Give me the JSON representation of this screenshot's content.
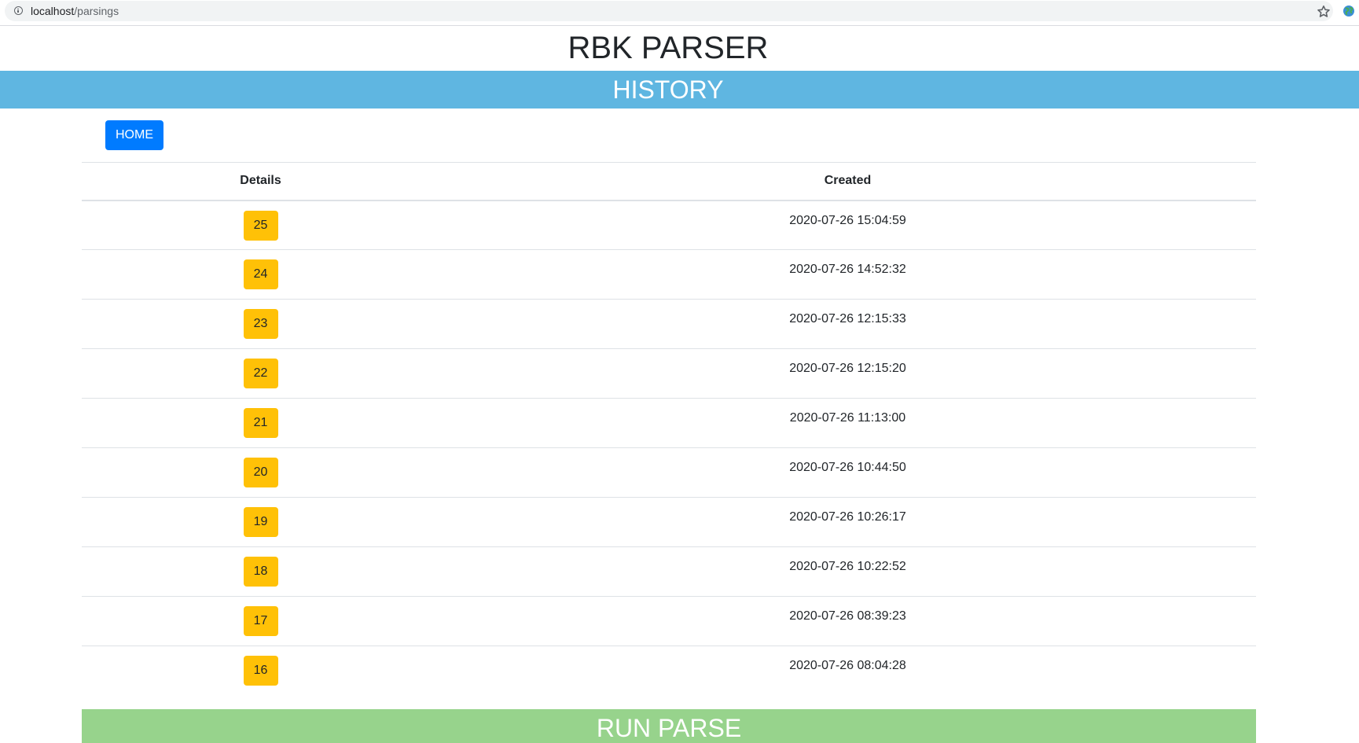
{
  "browser": {
    "url_host": "localhost",
    "url_path": "/parsings",
    "info_icon": "info-icon",
    "bookmark_icon": "star-icon",
    "extension_icon": "globe-icon"
  },
  "header": {
    "title": "RBK PARSER"
  },
  "section": {
    "title": "HISTORY",
    "color": "#5fb6e1"
  },
  "nav": {
    "home_label": "HOME",
    "home_color": "#007bff"
  },
  "table": {
    "columns": [
      "Details",
      "Created"
    ],
    "badge_color": "#ffc107",
    "rows": [
      {
        "id": "25",
        "created": "2020-07-26 15:04:59"
      },
      {
        "id": "24",
        "created": "2020-07-26 14:52:32"
      },
      {
        "id": "23",
        "created": "2020-07-26 12:15:33"
      },
      {
        "id": "22",
        "created": "2020-07-26 12:15:20"
      },
      {
        "id": "21",
        "created": "2020-07-26 11:13:00"
      },
      {
        "id": "20",
        "created": "2020-07-26 10:44:50"
      },
      {
        "id": "19",
        "created": "2020-07-26 10:26:17"
      },
      {
        "id": "18",
        "created": "2020-07-26 10:22:52"
      },
      {
        "id": "17",
        "created": "2020-07-26 08:39:23"
      },
      {
        "id": "16",
        "created": "2020-07-26 08:04:28"
      }
    ]
  },
  "actions": {
    "run_parse_label": "RUN PARSE",
    "run_parse_color": "#97d38c"
  }
}
